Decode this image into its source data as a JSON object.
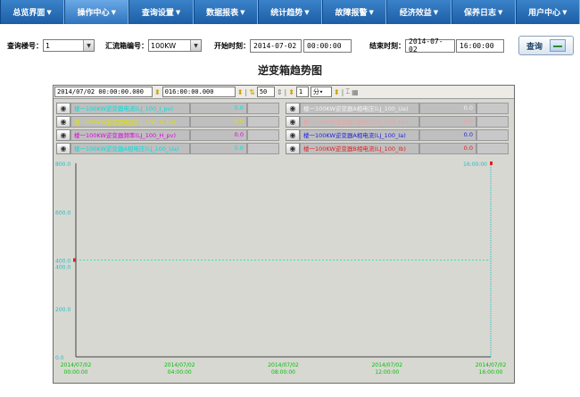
{
  "nav": [
    {
      "label": "总览界面"
    },
    {
      "label": "操作中心"
    },
    {
      "label": "查询设置"
    },
    {
      "label": "数据报表"
    },
    {
      "label": "统计趋势"
    },
    {
      "label": "故障报警"
    },
    {
      "label": "经济效益"
    },
    {
      "label": "保养日志"
    },
    {
      "label": "用户中心"
    }
  ],
  "query": {
    "floor_label": "查询楼号：",
    "floor_value": "1",
    "box_label": "汇流箱编号：",
    "box_value": "100KW",
    "start_label": "开始时刻：",
    "start_date": "2014-07-02",
    "start_time": "00:00:00",
    "end_label": "结束时刻：",
    "end_date": "2014-07-02",
    "end_time": "16:00:00",
    "button_label": "查询"
  },
  "page_title": "逆变箱趋势图",
  "toolbar": {
    "start": "2014/07/02 00:00:00.000",
    "end": "016:00:00.000",
    "step": "50",
    "interval": "1",
    "unit": "分"
  },
  "legend": {
    "left": [
      {
        "name": "楼一100KW逆变器电流(LJ_100_I_pv)",
        "value": "0.0",
        "color": "#00e0e0"
      },
      {
        "name": "楼一100KW逆变器电压(LJ_100_U_pv)",
        "value": "0.0",
        "color": "#e0e000"
      },
      {
        "name": "楼一100KW逆变器频率(LJ_100_H_pv)",
        "value": "0.0",
        "color": "#e000e0"
      },
      {
        "name": "楼一100KW逆变器A相电压(LJ_100_Ua)",
        "value": "0.0",
        "color": "#00e0e0"
      }
    ],
    "right": [
      {
        "name": "楼一100KW逆变器A相电压(LJ_100_Ua)",
        "value": "0.0",
        "color": "#f4f4f4"
      },
      {
        "name": "楼一100KW逆变器C相电压(LJ_100_Uc)",
        "value": "0.0",
        "color": "#f0a0a0"
      },
      {
        "name": "楼一100KW逆变器A相电流(LJ_100_Ia)",
        "value": "0.0",
        "color": "#2020e0"
      },
      {
        "name": "楼一100KW逆变器B相电流(LJ_100_Ib)",
        "value": "0.0",
        "color": "#e02020"
      }
    ]
  },
  "chart_data": {
    "type": "line",
    "y_ticks": [
      "800.0",
      "600.0",
      "400.0",
      "200.0",
      "0.0"
    ],
    "ylim": [
      0,
      800
    ],
    "x_ticks": [
      {
        "date": "2014/07/02",
        "time": "00:00:00"
      },
      {
        "date": "2014/07/02",
        "time": "04:00:00"
      },
      {
        "date": "2014/07/02",
        "time": "08:00:00"
      },
      {
        "date": "2014/07/02",
        "time": "12:00:00"
      },
      {
        "date": "2014/07/02",
        "time": "16:00:00"
      }
    ],
    "y_labels_secondary": {
      "top_right": "16:00:00",
      "left_mid": "400.0"
    },
    "series": [
      {
        "value": 400,
        "color": "#40e0a0"
      }
    ],
    "colors": {
      "grid": "#a8a8a8",
      "axis_text": "#00c000",
      "y_text": "#20c0c0"
    }
  }
}
